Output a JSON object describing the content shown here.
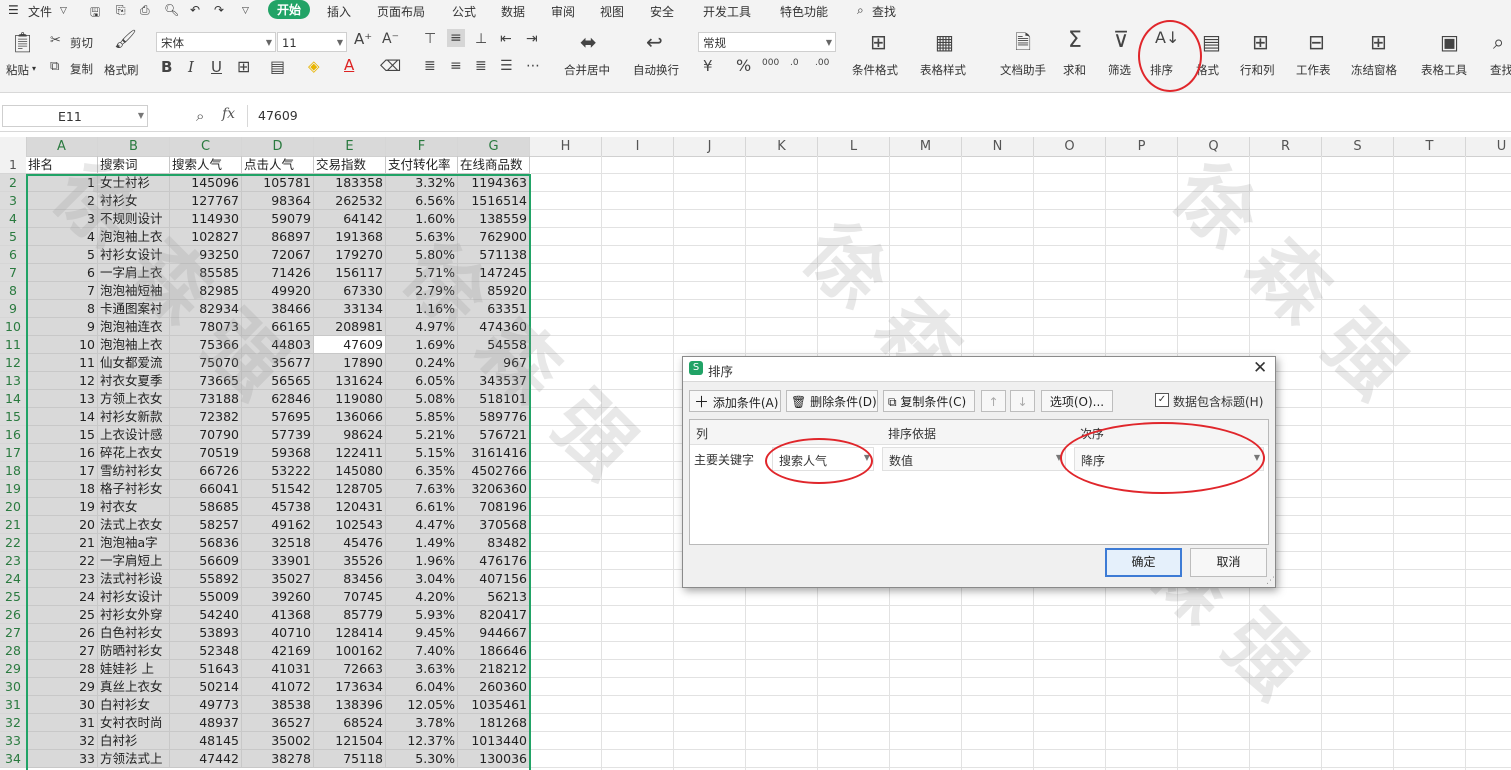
{
  "menu": {
    "file": "文件",
    "tabs": [
      "开始",
      "插入",
      "页面布局",
      "公式",
      "数据",
      "审阅",
      "视图",
      "安全",
      "开发工具",
      "特色功能"
    ],
    "search": "查找"
  },
  "toolbar": {
    "paste": "粘贴",
    "cut": "剪切",
    "copy": "复制",
    "format_painter": "格式刷",
    "font_name": "宋体",
    "font_size": "11",
    "merge_center": "合并居中",
    "wrap_text": "自动换行",
    "number_format": "常规",
    "conditional_format": "条件格式",
    "table_style": "表格样式",
    "doc_helper": "文档助手",
    "sum": "求和",
    "filter": "筛选",
    "sort": "排序",
    "format": "格式",
    "row_col": "行和列",
    "worksheet": "工作表",
    "freeze": "冻结窗格",
    "table_tools": "表格工具",
    "find": "查找",
    "percent": "%",
    "thousands": "000"
  },
  "formula_bar": {
    "cell_ref": "E11",
    "fx": "fx",
    "value": "47609"
  },
  "columns": [
    "A",
    "B",
    "C",
    "D",
    "E",
    "F",
    "G",
    "H",
    "I",
    "J",
    "K",
    "L",
    "M",
    "N",
    "O",
    "P",
    "Q",
    "R",
    "S",
    "T",
    "U"
  ],
  "header_row": [
    "排名",
    "搜索词",
    "搜索人气",
    "点击人气",
    "交易指数",
    "支付转化率",
    "在线商品数"
  ],
  "rows": [
    [
      "1",
      "女士衬衫",
      "145096",
      "105781",
      "183358",
      "3.32%",
      "1194363"
    ],
    [
      "2",
      "衬衫女",
      "127767",
      "98364",
      "262532",
      "6.56%",
      "1516514"
    ],
    [
      "3",
      "不规则设计",
      "114930",
      "59079",
      "64142",
      "1.60%",
      "138559"
    ],
    [
      "4",
      "泡泡袖上衣",
      "102827",
      "86897",
      "191368",
      "5.63%",
      "762900"
    ],
    [
      "5",
      "衬衫女设计",
      "93250",
      "72067",
      "179270",
      "5.80%",
      "571138"
    ],
    [
      "6",
      "一字肩上衣",
      "85585",
      "71426",
      "156117",
      "5.71%",
      "147245"
    ],
    [
      "7",
      "泡泡袖短袖",
      "82985",
      "49920",
      "67330",
      "2.79%",
      "85920"
    ],
    [
      "8",
      "卡通图案衬",
      "82934",
      "38466",
      "33134",
      "1.16%",
      "63351"
    ],
    [
      "9",
      "泡泡袖连衣",
      "78073",
      "66165",
      "208981",
      "4.97%",
      "474360"
    ],
    [
      "10",
      "泡泡袖上衣",
      "75366",
      "44803",
      "47609",
      "1.69%",
      "54558"
    ],
    [
      "11",
      "仙女都爱流",
      "75070",
      "35677",
      "17890",
      "0.24%",
      "967"
    ],
    [
      "12",
      "衬衣女夏季",
      "73665",
      "56565",
      "131624",
      "6.05%",
      "343537"
    ],
    [
      "13",
      "方领上衣女",
      "73188",
      "62846",
      "119080",
      "5.08%",
      "518101"
    ],
    [
      "14",
      "衬衫女新款",
      "72382",
      "57695",
      "136066",
      "5.85%",
      "589776"
    ],
    [
      "15",
      "上衣设计感",
      "70790",
      "57739",
      "98624",
      "5.21%",
      "576721"
    ],
    [
      "16",
      "碎花上衣女",
      "70519",
      "59368",
      "122411",
      "5.15%",
      "3161416"
    ],
    [
      "17",
      "雪纺衬衫女",
      "66726",
      "53222",
      "145080",
      "6.35%",
      "4502766"
    ],
    [
      "18",
      "格子衬衫女",
      "66041",
      "51542",
      "128705",
      "7.63%",
      "3206360"
    ],
    [
      "19",
      "衬衣女",
      "58685",
      "45738",
      "120431",
      "6.61%",
      "708196"
    ],
    [
      "20",
      "法式上衣女",
      "58257",
      "49162",
      "102543",
      "4.47%",
      "370568"
    ],
    [
      "21",
      "泡泡袖a字",
      "56836",
      "32518",
      "45476",
      "1.49%",
      "83482"
    ],
    [
      "22",
      "一字肩短上",
      "56609",
      "33901",
      "35526",
      "1.96%",
      "476176"
    ],
    [
      "23",
      "法式衬衫设",
      "55892",
      "35027",
      "83456",
      "3.04%",
      "407156"
    ],
    [
      "24",
      "衬衫女设计",
      "55009",
      "39260",
      "70745",
      "4.20%",
      "56213"
    ],
    [
      "25",
      "衬衫女外穿",
      "54240",
      "41368",
      "85779",
      "5.93%",
      "820417"
    ],
    [
      "26",
      "白色衬衫女",
      "53893",
      "40710",
      "128414",
      "9.45%",
      "944667"
    ],
    [
      "27",
      "防晒衬衫女",
      "52348",
      "42169",
      "100162",
      "7.40%",
      "186646"
    ],
    [
      "28",
      "娃娃衫 上",
      "51643",
      "41031",
      "72663",
      "3.63%",
      "218212"
    ],
    [
      "29",
      "真丝上衣女",
      "50214",
      "41072",
      "173634",
      "6.04%",
      "260360"
    ],
    [
      "30",
      "白衬衫女",
      "49773",
      "38538",
      "138396",
      "12.05%",
      "1035461"
    ],
    [
      "31",
      "女衬衣时尚",
      "48937",
      "36527",
      "68524",
      "3.78%",
      "181268"
    ],
    [
      "32",
      "白衬衫",
      "48145",
      "35002",
      "121504",
      "12.37%",
      "1013440"
    ],
    [
      "33",
      "方领法式上",
      "47442",
      "38278",
      "75118",
      "5.30%",
      "130036"
    ]
  ],
  "dialog": {
    "title": "排序",
    "add_condition": "添加条件(A)",
    "delete_condition": "删除条件(D)",
    "copy_condition": "复制条件(C)",
    "options": "选项(O)...",
    "has_header_label": "数据包含标题(H)",
    "has_header_checked": true,
    "col_header": "列",
    "basis_header": "排序依据",
    "order_header": "次序",
    "primary_key_label": "主要关键字",
    "primary_key_value": "搜索人气",
    "basis_value": "数值",
    "order_value": "降序",
    "ok": "确定",
    "cancel": "取消"
  },
  "colors": {
    "accent_green": "#21a366",
    "annotation_red": "#e0262b",
    "selection_gray": "#d9d9d9"
  }
}
